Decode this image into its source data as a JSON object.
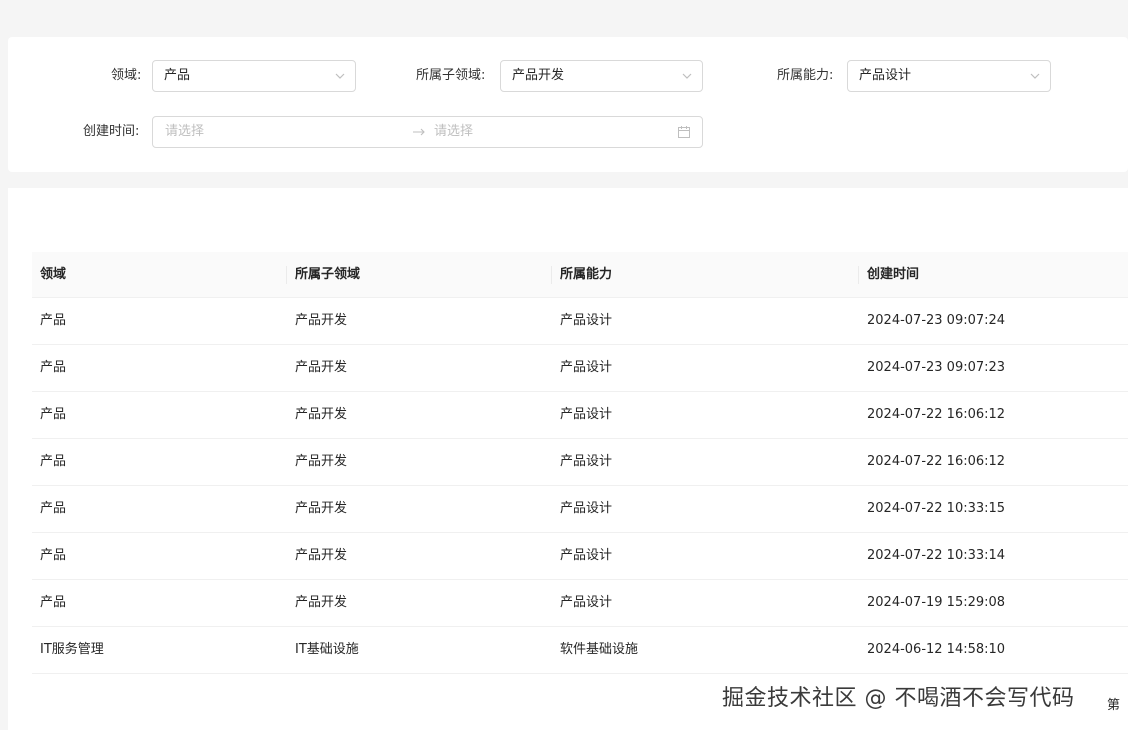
{
  "filters": {
    "domain": {
      "label": "领域:",
      "value": "产品"
    },
    "subdomain": {
      "label": "所属子领域:",
      "value": "产品开发"
    },
    "capability": {
      "label": "所属能力:",
      "value": "产品设计"
    },
    "created_time": {
      "label": "创建时间:",
      "start_placeholder": "请选择",
      "end_placeholder": "请选择"
    }
  },
  "table": {
    "columns": [
      "领域",
      "所属子领域",
      "所属能力",
      "创建时间"
    ],
    "rows": [
      [
        "产品",
        "产品开发",
        "产品设计",
        "2024-07-23 09:07:24"
      ],
      [
        "产品",
        "产品开发",
        "产品设计",
        "2024-07-23 09:07:23"
      ],
      [
        "产品",
        "产品开发",
        "产品设计",
        "2024-07-22 16:06:12"
      ],
      [
        "产品",
        "产品开发",
        "产品设计",
        "2024-07-22 16:06:12"
      ],
      [
        "产品",
        "产品开发",
        "产品设计",
        "2024-07-22 10:33:15"
      ],
      [
        "产品",
        "产品开发",
        "产品设计",
        "2024-07-22 10:33:14"
      ],
      [
        "产品",
        "产品开发",
        "产品设计",
        "2024-07-19 15:29:08"
      ],
      [
        "IT服务管理",
        "IT基础设施",
        "软件基础设施",
        "2024-06-12 14:58:10"
      ]
    ]
  },
  "pagination": {
    "prefix": "第"
  },
  "watermark": "掘金技术社区 @ 不喝酒不会写代码",
  "icons": {
    "select_arrow": "chevron-down-icon",
    "range_separator": "arrow-right-icon",
    "date_picker": "calendar-icon"
  }
}
